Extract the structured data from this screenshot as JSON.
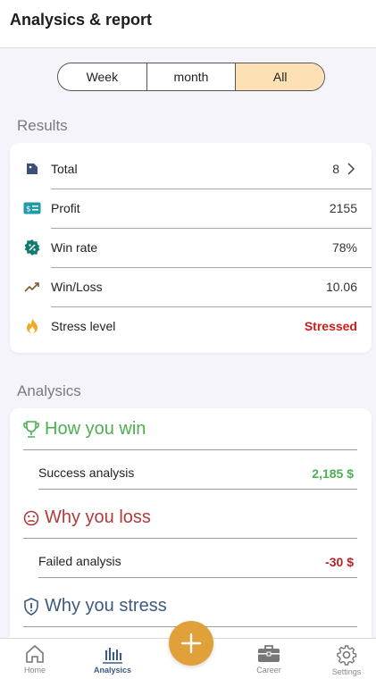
{
  "header": {
    "title": "Analysics & report"
  },
  "period_tabs": [
    {
      "label": "Week",
      "active": false
    },
    {
      "label": "month",
      "active": false
    },
    {
      "label": "All",
      "active": true
    }
  ],
  "results": {
    "section_label": "Results",
    "rows": [
      {
        "icon": "bookmark-tag-icon",
        "label": "Total",
        "value": "8"
      },
      {
        "icon": "money-bill-icon",
        "label": "Profit",
        "value": "2155"
      },
      {
        "icon": "percent-badge-icon",
        "label": "Win rate",
        "value": "78%"
      },
      {
        "icon": "trend-up-icon",
        "label": "Win/Loss",
        "value": "10.06"
      },
      {
        "icon": "flame-icon",
        "label": "Stress level",
        "value": "Stressed"
      }
    ]
  },
  "analytics": {
    "section_label": "Analysics",
    "win": {
      "title": "How you win",
      "row_label": "Success analysis",
      "row_value": "2,185 $"
    },
    "loss": {
      "title": "Why you loss",
      "row_label": "Failed analysis",
      "row_value": "-30 $"
    },
    "stress": {
      "title": "Why you stress"
    }
  },
  "colors": {
    "accent": "#e0a03a",
    "active_tab": "#fde0b4",
    "win": "#4caf50",
    "loss": "#b33a3a",
    "stress_text": "#d11a1a",
    "nav_active": "#3d5a80"
  },
  "bottom_nav": {
    "items": [
      {
        "icon": "home-icon",
        "label": "Home",
        "active": false
      },
      {
        "icon": "bar-chart-icon",
        "label": "Analysics",
        "active": true
      },
      {
        "icon": "briefcase-icon",
        "label": "Career",
        "active": false
      },
      {
        "icon": "gear-icon",
        "label": "Settings",
        "active": false
      }
    ],
    "fab_icon": "plus-icon"
  }
}
